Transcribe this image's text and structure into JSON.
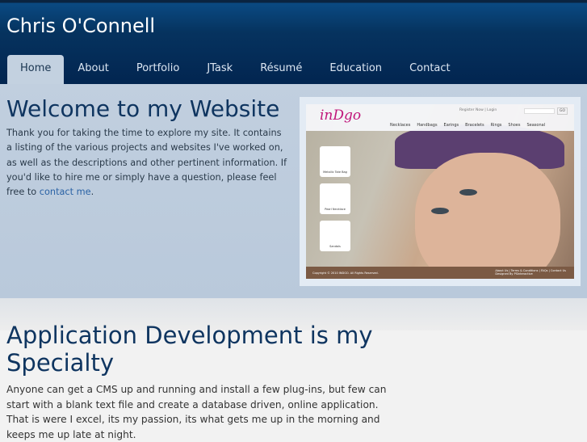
{
  "header": {
    "title": "Chris O'Connell"
  },
  "nav": [
    {
      "label": "Home",
      "active": true
    },
    {
      "label": "About"
    },
    {
      "label": "Portfolio"
    },
    {
      "label": "JTask"
    },
    {
      "label": "Résumé"
    },
    {
      "label": "Education"
    },
    {
      "label": "Contact"
    }
  ],
  "welcome": {
    "title": "Welcome to my Website",
    "text": "Thank you for taking the time to explore my site. It contains a listing of the various projects and websites I've worked on, as well as the descriptions and other pertinent information. If you'd like to hire me or simply have a question, please feel free to ",
    "link": "contact me",
    "after": "."
  },
  "screenshot": {
    "logo": "inDgo",
    "links": "Register Now | Login",
    "go": "GO",
    "menu": [
      "Necklaces",
      "Handbags",
      "Earings",
      "Bracelets",
      "Rings",
      "Shoes",
      "Seasonal"
    ],
    "cards": [
      "Metallic Tote Bag",
      "Pearl Necklace",
      "Sandals"
    ],
    "copyright": "Copyright © 2010 INDGO. All Rights Reserved.",
    "footer_links": "About Us | Terms & Conditions | FAQs | Contact Us",
    "designed": "Designed By PSInteractive"
  },
  "section": {
    "title": "Application Development is my Specialty",
    "text": "Anyone can get a CMS up and running and install a few plug-ins, but few can start with a blank text file and create a database driven, online application. That is were I excel, its my passion, its what gets me up in the morning and keeps me up late at night."
  }
}
